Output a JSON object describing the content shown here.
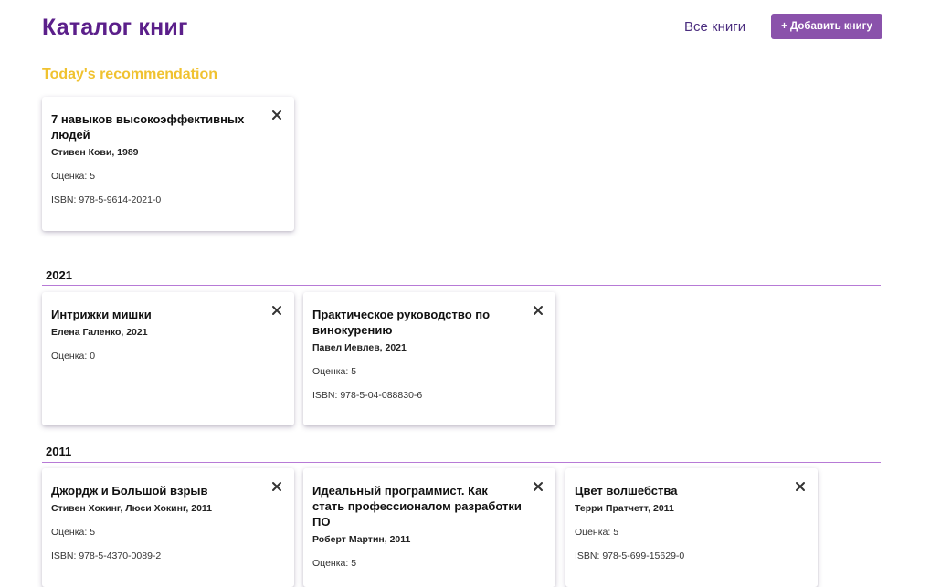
{
  "header": {
    "title": "Каталог книг",
    "nav_link": "Все книги",
    "add_button": "+ Добавить книгу"
  },
  "recommendation": {
    "heading": "Today's recommendation",
    "book": {
      "title": "7 навыков высокоэффективных людей",
      "author_line": "Стивен Кови, 1989",
      "rating": "Оценка: 5",
      "isbn": "ISBN: 978-5-9614-2021-0"
    }
  },
  "groups": [
    {
      "year": "2021",
      "books": [
        {
          "title": "Интрижки мишки",
          "author_line": "Елена Галенко, 2021",
          "rating": "Оценка: 0",
          "isbn": ""
        },
        {
          "title": "Практическое руководство по винокурению",
          "author_line": "Павел Иевлев, 2021",
          "rating": "Оценка: 5",
          "isbn": "ISBN: 978-5-04-088830-6"
        }
      ]
    },
    {
      "year": "2011",
      "books": [
        {
          "title": "Джордж и Большой взрыв",
          "author_line": "Стивен Хокинг, Люси Хокинг, 2011",
          "rating": "Оценка: 5",
          "isbn": "ISBN: 978-5-4370-0089-2"
        },
        {
          "title": "Идеальный программист. Как стать профессионалом разработки ПО",
          "author_line": "Роберт Мартин, 2011",
          "rating": "Оценка: 5",
          "isbn": ""
        },
        {
          "title": "Цвет волшебства",
          "author_line": "Терри Пратчетт, 2011",
          "rating": "Оценка: 5",
          "isbn": "ISBN: 978-5-699-15629-0"
        }
      ]
    }
  ],
  "colors": {
    "title": "#5b1f8a",
    "accent_button": "#8a52ab",
    "recommendation_heading": "#f0c230",
    "divider": "#b77ad6"
  },
  "icons": {
    "close": "close-icon"
  }
}
